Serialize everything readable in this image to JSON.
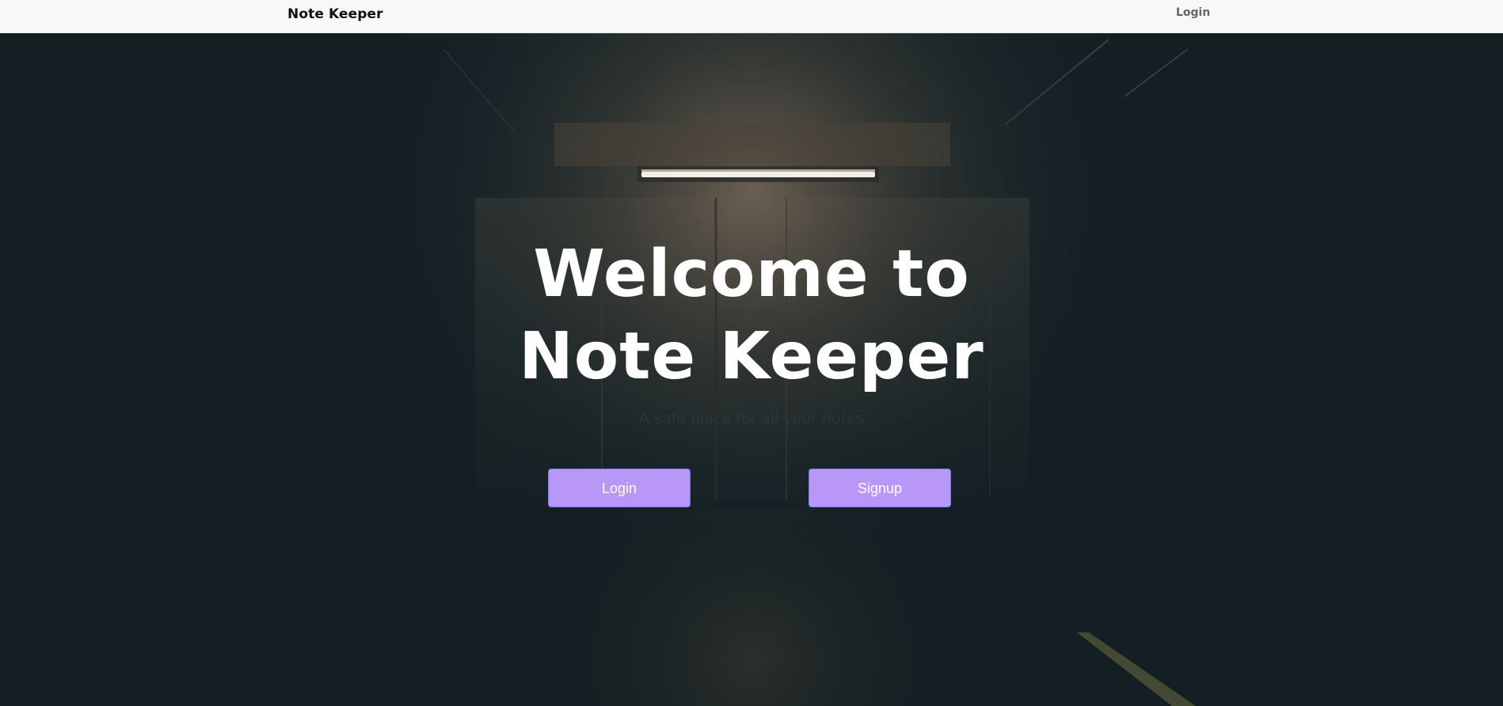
{
  "navbar": {
    "brand": "Note Keeper",
    "login_label": "Login"
  },
  "hero": {
    "title": "Welcome to Note Keeper",
    "subtitle": "A safe place for all your notes",
    "login_button": "Login",
    "signup_button": "Signup"
  },
  "colors": {
    "navbar_bg": "#f8f8f8",
    "hero_bg": "#131f23",
    "button_bg": "#b997f9",
    "button_border": "#6f7cf0",
    "title_text": "#ffffff"
  }
}
